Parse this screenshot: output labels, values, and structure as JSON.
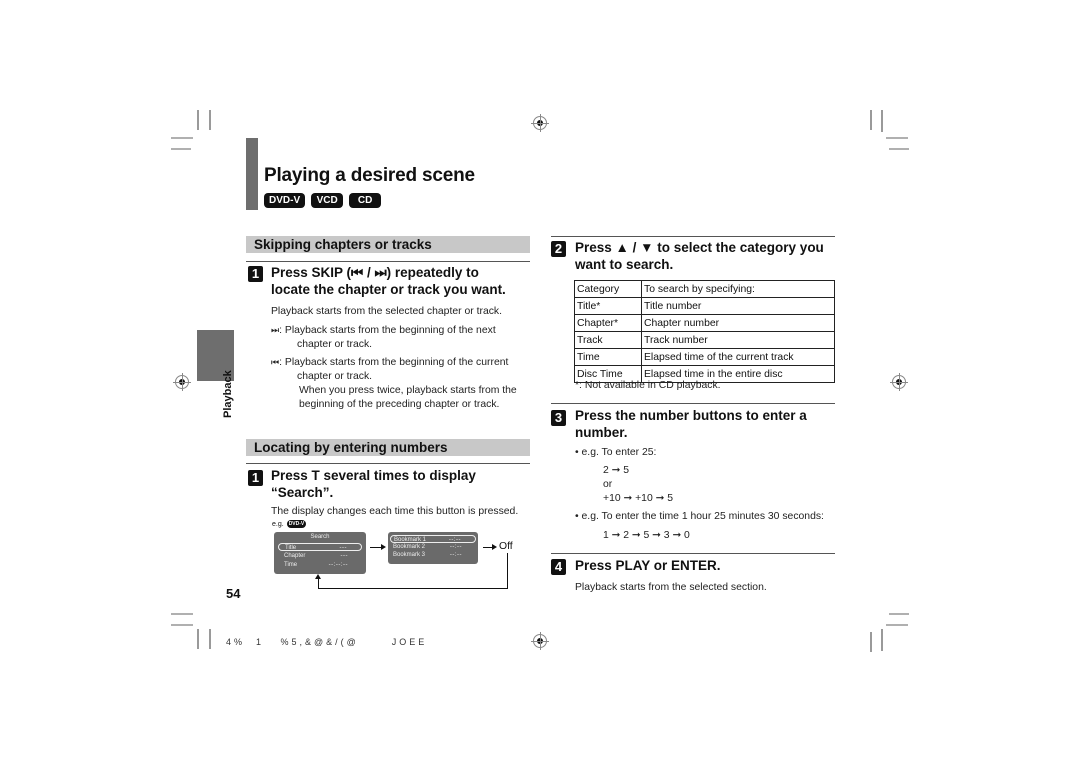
{
  "page": {
    "title": "Playing a desired scene",
    "badges": [
      "DVD-V",
      "VCD",
      "CD"
    ],
    "side_tab_label": "Playback",
    "page_number": "54",
    "footer_code": "4%  1   %5,&@&/(@      JOEE"
  },
  "skipping": {
    "header": "Skipping chapters or tracks",
    "step1": {
      "number": "1",
      "title_line1": "Press SKIP (⏮ / ⏭) repeatedly to",
      "title_line2": "locate the chapter or track you want.",
      "desc": "Playback starts from the selected chapter or track.",
      "next_icon": "⏭",
      "next_line1": ": Playback starts from the beginning of the next",
      "next_line2": "chapter or track.",
      "prev_icon": "⏮",
      "prev_line1": ": Playback starts from the beginning of the current",
      "prev_line2": "chapter or track.",
      "twice_line1": "When you press twice, playback starts from the",
      "twice_line2": "beginning of the preceding chapter or track."
    }
  },
  "locating": {
    "header": "Locating by entering numbers",
    "step1": {
      "number": "1",
      "title_line1": "Press T several times to display",
      "title_line2": "“Search”.",
      "desc": "The display changes each time this button is pressed.",
      "eg_label": "e.g.",
      "eg_badge": "DVD-V",
      "search_osd": {
        "title": "Search",
        "rows": [
          {
            "label": "Title",
            "value": "---",
            "selected": true
          },
          {
            "label": "Chapter",
            "value": "---",
            "selected": false
          },
          {
            "label": "Time",
            "value": "--:--:--",
            "selected": false
          }
        ]
      },
      "bookmark_osd": {
        "rows": [
          {
            "label": "Bookmark 1",
            "value": "--:--",
            "selected": true
          },
          {
            "label": "Bookmark 2",
            "value": "--:--",
            "selected": false
          },
          {
            "label": "Bookmark 3",
            "value": "--:--",
            "selected": false
          }
        ]
      },
      "off_label": "Off"
    },
    "step2": {
      "number": "2",
      "title_line1": "Press ▲ / ▼ to select the category you",
      "title_line2": "want to search.",
      "table": {
        "headers": [
          "Category",
          "To search by specifying:"
        ],
        "rows": [
          [
            "Title*",
            "Title number"
          ],
          [
            "Chapter*",
            "Chapter number"
          ],
          [
            "Track",
            "Track number"
          ],
          [
            "Time",
            "Elapsed time of the current track"
          ],
          [
            "Disc Time",
            "Elapsed time in the entire disc"
          ]
        ]
      },
      "footnote": "*: Not available in CD playback."
    },
    "step3": {
      "number": "3",
      "title_line1": "Press the number buttons to enter a",
      "title_line2": "number.",
      "eg1": "• e.g. To enter 25:",
      "eg1_seq1": "2 ➞ 5",
      "eg1_or": "or",
      "eg1_seq2": "+10 ➞ +10 ➞ 5",
      "eg2": "• e.g. To enter the time 1 hour 25 minutes 30 seconds:",
      "eg2_seq": "1 ➞ 2 ➞ 5 ➞ 3 ➞ 0"
    },
    "step4": {
      "number": "4",
      "title": "Press PLAY or ENTER.",
      "desc": "Playback starts from the selected section."
    }
  }
}
